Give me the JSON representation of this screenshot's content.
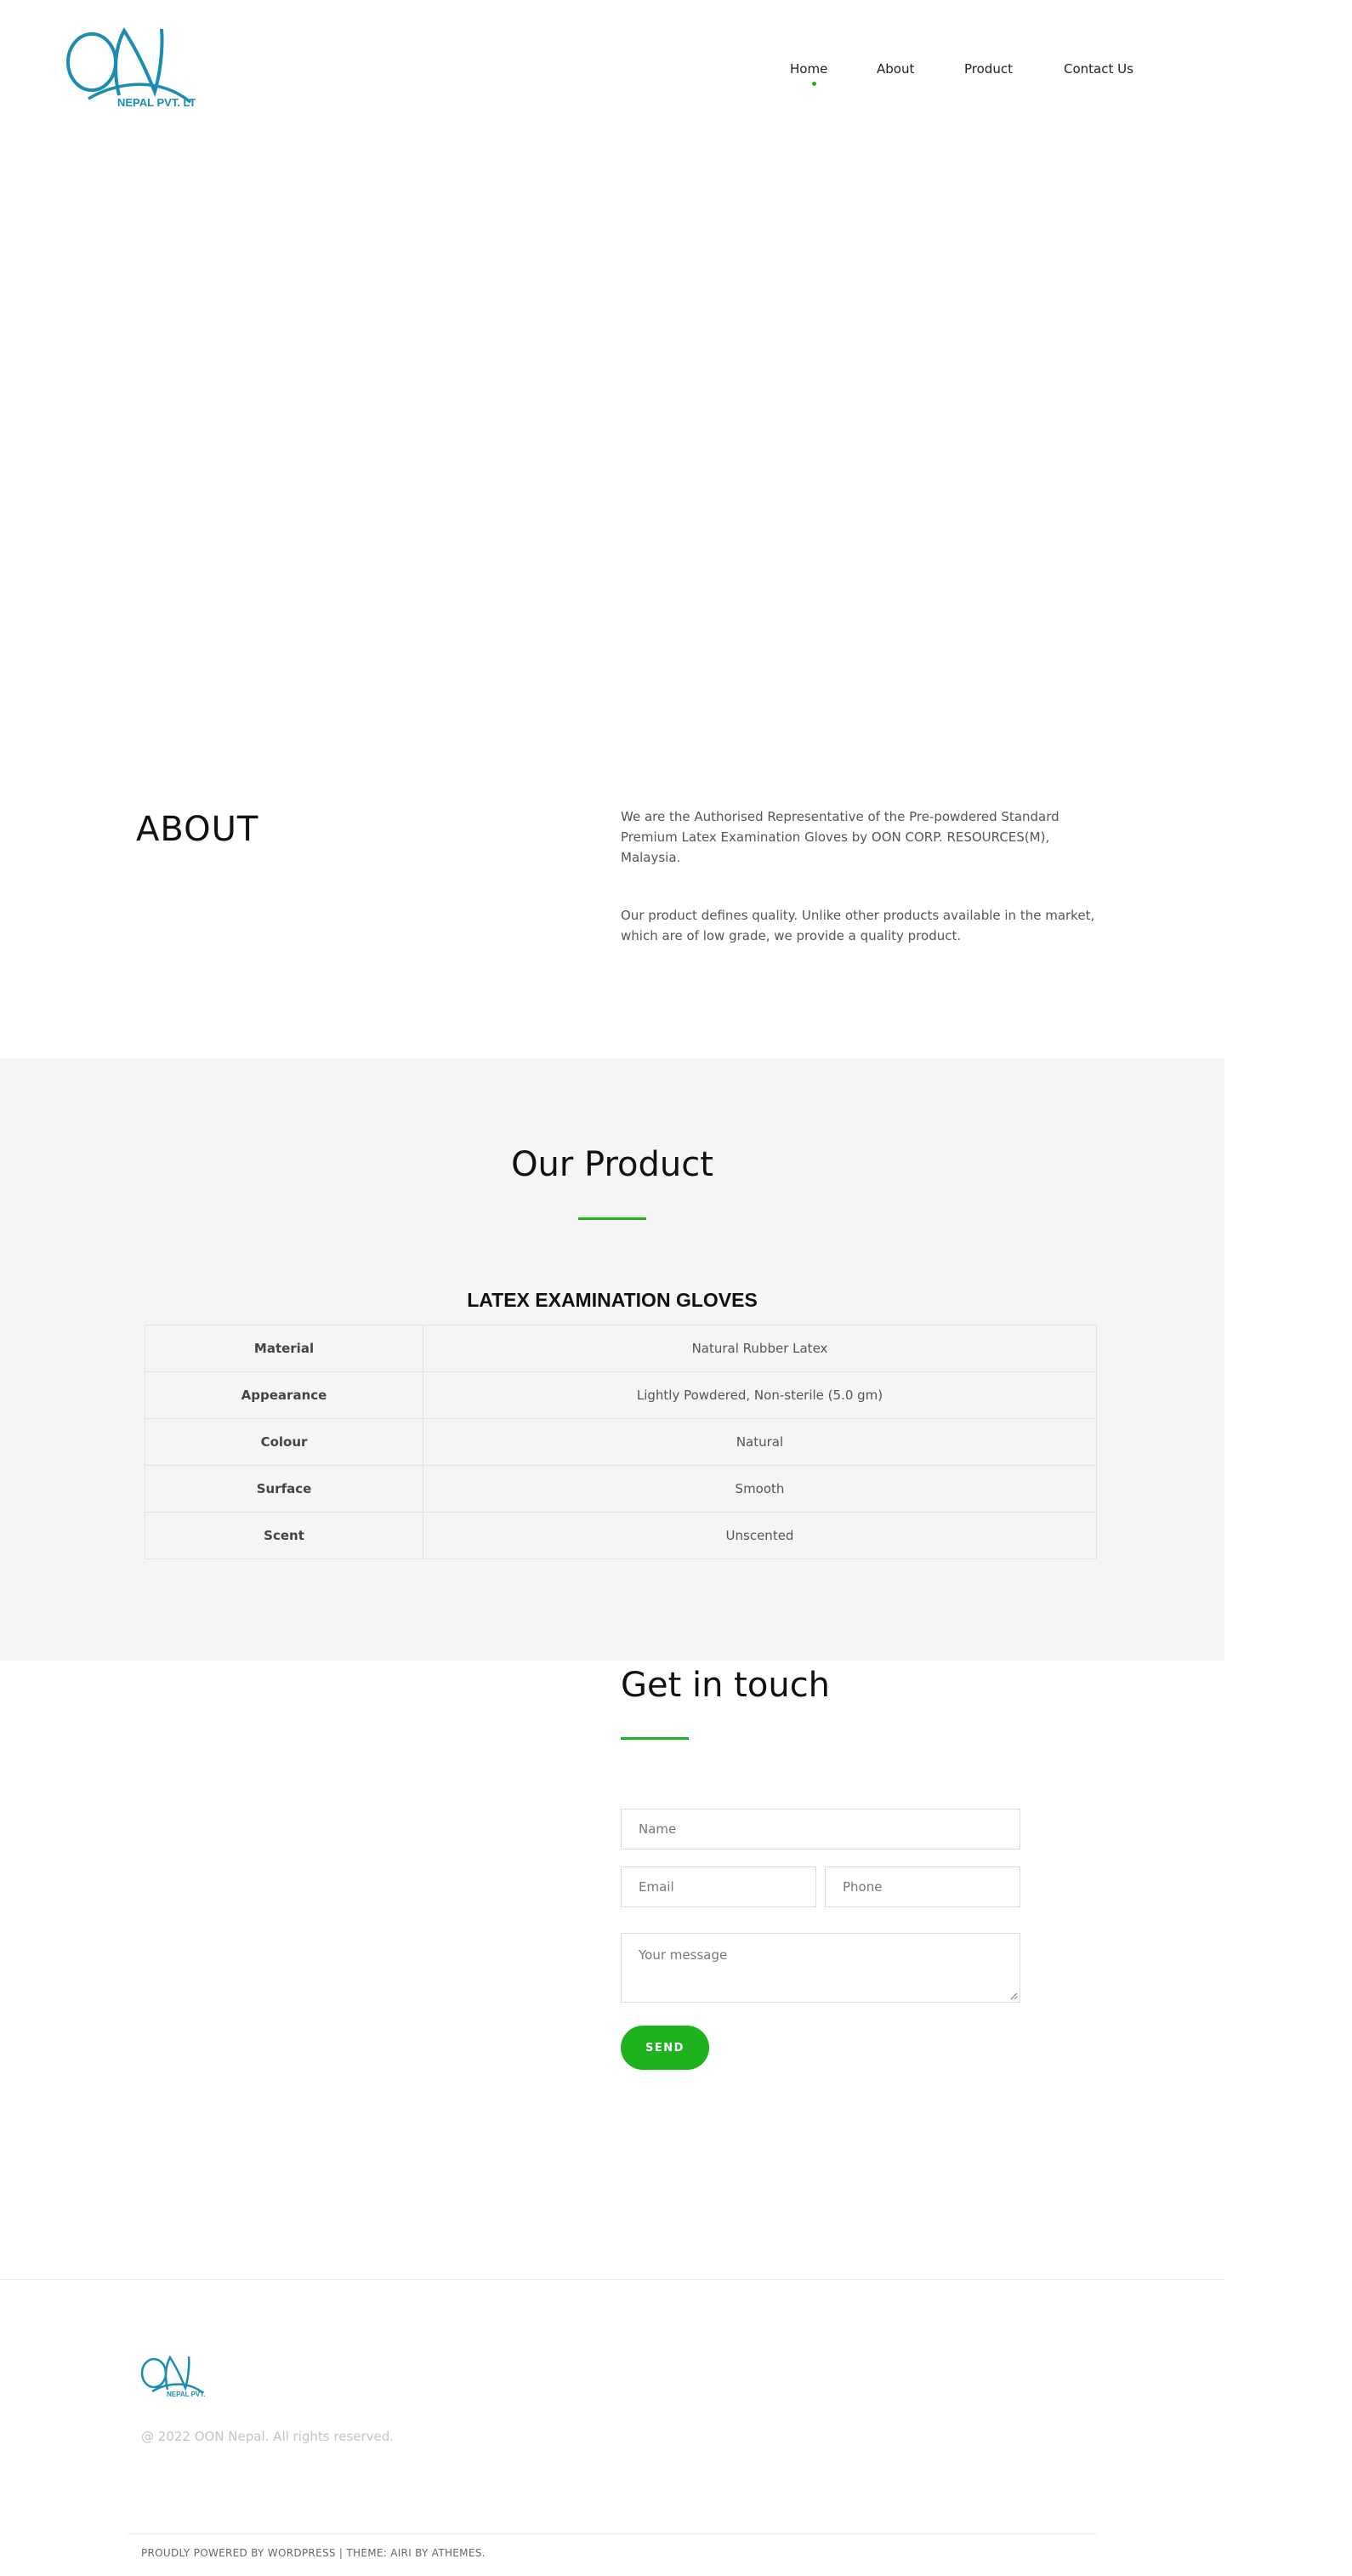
{
  "brand": {
    "logo_main": "ON",
    "logo_sub": "NEPAL PVT. LTD.",
    "color": "#1a8db0"
  },
  "nav": {
    "items": [
      {
        "label": "Home",
        "active": true
      },
      {
        "label": "About",
        "active": false
      },
      {
        "label": "Product",
        "active": false
      },
      {
        "label": "Contact Us",
        "active": false
      }
    ]
  },
  "about": {
    "title": "ABOUT",
    "paragraph1": "We are the Authorised Representative of the Pre-powdered Standard Premium Latex Examination Gloves by OON CORP. RESOURCES(M), Malaysia.",
    "paragraph2": "Our product defines quality. Unlike other products available in the market, which are of low grade, we provide a quality product."
  },
  "product": {
    "title": "Our Product",
    "table_title": "LATEX EXAMINATION GLOVES",
    "specs": [
      {
        "key": "Material",
        "value": "Natural Rubber Latex"
      },
      {
        "key": "Appearance",
        "value": "Lightly Powdered, Non-sterile (5.0 gm)"
      },
      {
        "key": "Colour",
        "value": "Natural"
      },
      {
        "key": "Surface",
        "value": "Smooth"
      },
      {
        "key": "Scent",
        "value": "Unscented"
      }
    ]
  },
  "contact": {
    "title": "Get in touch",
    "name_placeholder": "Name",
    "email_placeholder": "Email",
    "phone_placeholder": "Phone",
    "message_placeholder": "Your message",
    "send_label": "SEND"
  },
  "footer": {
    "copyright": "@ 2022 OON Nepal. All rights reserved.",
    "credits_powered": "PROUDLY POWERED BY WORDPRESS",
    "credits_sep": " | ",
    "credits_theme": "THEME: AIRI BY ATHEMES."
  },
  "colors": {
    "accent": "#1fb21f",
    "section_bg": "#f5f5f5",
    "logo": "#1a8db0"
  }
}
